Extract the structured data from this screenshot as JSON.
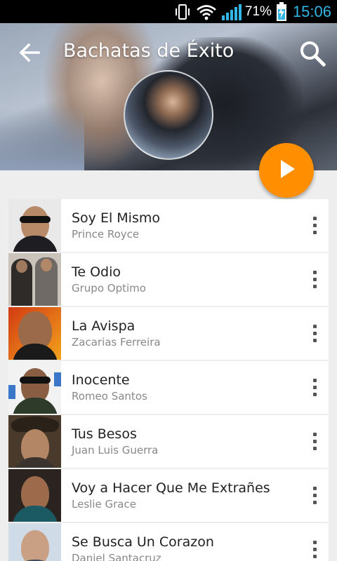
{
  "status_bar": {
    "battery_percent": "71%",
    "clock": "15:06",
    "icons": [
      "vibrate-icon",
      "wifi-icon",
      "signal-icon",
      "battery-charging-icon"
    ]
  },
  "header": {
    "title": "Bachatas de Éxito",
    "back_icon": "arrow-back-icon",
    "search_icon": "search-icon",
    "play_icon": "play-icon",
    "accent_color": "#ff8f00"
  },
  "songs": [
    {
      "title": "Soy El Mismo",
      "artist": "Prince Royce"
    },
    {
      "title": "Te Odio",
      "artist": "Grupo Optimo"
    },
    {
      "title": "La Avispa",
      "artist": "Zacarias Ferreira"
    },
    {
      "title": "Inocente",
      "artist": "Romeo Santos"
    },
    {
      "title": "Tus Besos",
      "artist": "Juan Luis Guerra"
    },
    {
      "title": "Voy a Hacer Que Me Extrañes",
      "artist": "Leslie Grace"
    },
    {
      "title": "Se Busca Un Corazon",
      "artist": "Daniel Santacruz"
    }
  ]
}
